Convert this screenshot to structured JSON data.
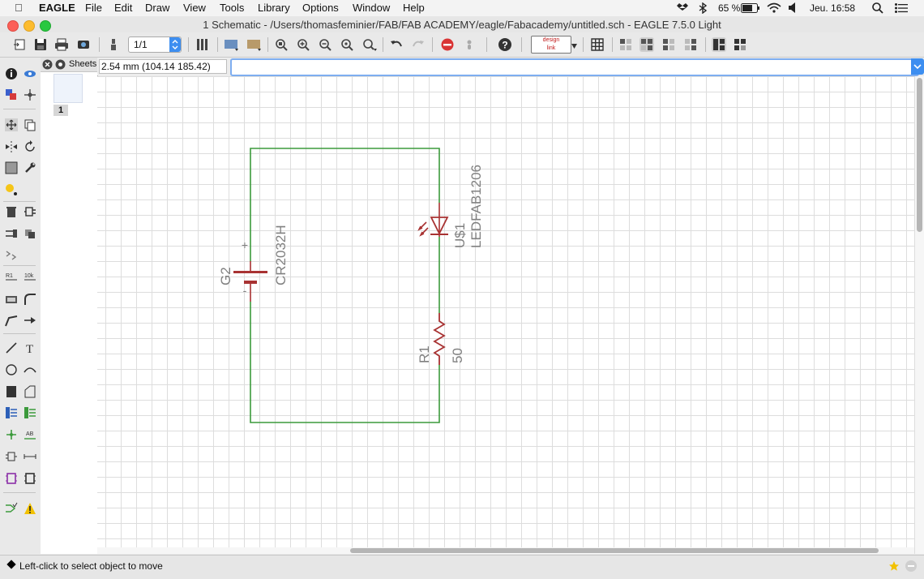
{
  "menubar": {
    "app_name": "EAGLE",
    "items": [
      "File",
      "Edit",
      "Draw",
      "View",
      "Tools",
      "Library",
      "Options",
      "Window",
      "Help"
    ],
    "battery": "65 %",
    "clock": "Jeu. 16:58"
  },
  "window": {
    "title": "1 Schematic - /Users/thomasfeminier/FAB/FAB ACADEMY/eagle/Fabacademy/untitled.sch - EAGLE 7.5.0 Light"
  },
  "toolbar": {
    "sheet_value": "1/1",
    "designlink_top": "design",
    "designlink_bottom": "link"
  },
  "sheets_panel": {
    "title": "Sheets",
    "sheet_number": "1"
  },
  "coord_bar": {
    "coordinates": "2.54 mm (104.14 185.42)",
    "command_value": ""
  },
  "schematic": {
    "battery": {
      "name": "G2",
      "value": "CR2032H",
      "plus": "+",
      "minus": "-"
    },
    "led": {
      "name": "U$1",
      "value": "LEDFAB1206"
    },
    "resistor": {
      "name": "R1",
      "value": "50"
    },
    "colors": {
      "wire": "#3c9a3c",
      "symbol": "#a83232",
      "label": "#808080",
      "grid": "#dddddd"
    }
  },
  "statusbar": {
    "message": "Left-click to select object to move"
  }
}
